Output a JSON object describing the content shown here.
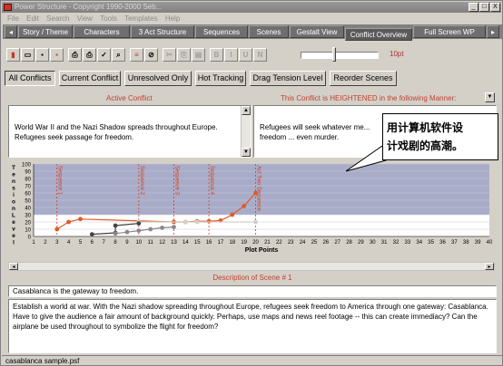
{
  "window": {
    "title": "Power Structure - Copyright 1990-2000 Seb...",
    "buttons": [
      "_",
      "□",
      "X"
    ]
  },
  "menu": [
    "File",
    "Edit",
    "Search",
    "View",
    "Tools",
    "Templates",
    "Help"
  ],
  "tabs": [
    {
      "label": "Story / Theme"
    },
    {
      "label": "Characters"
    },
    {
      "label": "3 Act Structure"
    },
    {
      "label": "Sequences"
    },
    {
      "label": "Scenes"
    },
    {
      "label": "Gestalt View"
    },
    {
      "label": "Conflict Overview"
    },
    {
      "label": "Full Screen WP"
    }
  ],
  "toolbar": {
    "buttons": [
      {
        "icon": "new-doc-icon",
        "glyph": "▮",
        "color": "#c0392b"
      },
      {
        "icon": "open-icon",
        "glyph": "▭",
        "color": "#000"
      },
      {
        "icon": "save-icon",
        "glyph": "▪",
        "color": "#000"
      },
      {
        "icon": "save-all-icon",
        "glyph": "▪",
        "color": "#c0392b"
      },
      {
        "icon": "print-icon",
        "glyph": "⎙",
        "color": "#000"
      },
      {
        "icon": "print-preview-icon",
        "glyph": "⎙",
        "color": "#000"
      },
      {
        "icon": "spell-check-icon",
        "glyph": "✓",
        "color": "#000"
      },
      {
        "icon": "find-icon",
        "glyph": "⌕",
        "color": "#000"
      },
      {
        "icon": "notes-icon",
        "glyph": "≡",
        "color": "#c0392b"
      },
      {
        "icon": "tag-icon",
        "glyph": "⊘",
        "color": "#000"
      },
      {
        "icon": "cut-icon",
        "glyph": "✂",
        "color": "#a0a0a0"
      },
      {
        "icon": "copy-icon",
        "glyph": "⎘",
        "color": "#a0a0a0"
      },
      {
        "icon": "paste-icon",
        "glyph": "▤",
        "color": "#a0a0a0"
      },
      {
        "icon": "bold-icon",
        "glyph": "B",
        "color": "#a0a0a0"
      },
      {
        "icon": "italic-icon",
        "glyph": "I",
        "color": "#a0a0a0"
      },
      {
        "icon": "underline-icon",
        "glyph": "U",
        "color": "#a0a0a0"
      },
      {
        "icon": "strike-icon",
        "glyph": "N",
        "color": "#a0a0a0"
      }
    ],
    "font_size": "10pt"
  },
  "conflict_tabs": [
    {
      "label": "All Conflicts"
    },
    {
      "label": "Current Conflict"
    },
    {
      "label": "Unresolved Only"
    },
    {
      "label": "Hot Tracking"
    },
    {
      "label": "Drag Tension Level"
    },
    {
      "label": "Reorder Scenes"
    }
  ],
  "active_conflict": {
    "label": "Active Conflict",
    "text": "World War II and the Nazi Shadow spreads throughout Europe. Refugees seek passage for freedom."
  },
  "heightened": {
    "label": "This Conflict is HEIGHTENED in the following Manner:",
    "text": "Refugees will seek whatever me... freedom ... even murder."
  },
  "callout": {
    "line1": "用计算机软件设",
    "line2": "计戏剧的高潮。"
  },
  "chart_data": {
    "type": "line",
    "ylabel": "Tension Level",
    "xlabel": "Plot Points",
    "xlim": [
      1,
      40
    ],
    "ylim": [
      0,
      100
    ],
    "yticks": [
      0,
      10,
      20,
      30,
      40,
      50,
      60,
      70,
      80,
      90,
      100
    ],
    "xticks": [
      1,
      2,
      3,
      4,
      5,
      6,
      7,
      8,
      9,
      10,
      11,
      12,
      13,
      14,
      15,
      16,
      17,
      18,
      19,
      20,
      21,
      22,
      23,
      24,
      25,
      26,
      27,
      28,
      29,
      30,
      31,
      32,
      33,
      34,
      35,
      36,
      37,
      38,
      39,
      40
    ],
    "markers": [
      {
        "x": 3,
        "label": "Sequence 1"
      },
      {
        "x": 10,
        "label": "Sequence 2"
      },
      {
        "x": 13,
        "label": "Sequence 3"
      },
      {
        "x": 16,
        "label": "Sequence 4"
      },
      {
        "x": 20,
        "label": "Act Two Sequence"
      }
    ],
    "series": [
      {
        "color": "#e05a2b",
        "points": [
          [
            3,
            10
          ],
          [
            4,
            20
          ],
          [
            5,
            24
          ],
          [
            13,
            20
          ],
          [
            14,
            20
          ],
          [
            15,
            21
          ],
          [
            16,
            21
          ],
          [
            17,
            22
          ],
          [
            18,
            30
          ],
          [
            19,
            42
          ],
          [
            20,
            60
          ]
        ]
      },
      {
        "color": "#d4d0c8",
        "points": [
          [
            10,
            20
          ],
          [
            14,
            20
          ],
          [
            15,
            20
          ],
          [
            20,
            20
          ]
        ]
      },
      {
        "color": "#444444",
        "points": [
          [
            6,
            3
          ],
          [
            8,
            5
          ],
          [
            8,
            15
          ],
          [
            10,
            18
          ]
        ]
      },
      {
        "color": "#888888",
        "points": [
          [
            8,
            4
          ],
          [
            9,
            6
          ],
          [
            10,
            8
          ],
          [
            11,
            10
          ],
          [
            12,
            12
          ],
          [
            13,
            13
          ]
        ]
      }
    ]
  },
  "description": {
    "label": "Description of Scene # 1",
    "summary": "Casablanca is the gateway to freedom.",
    "body": "Establish a world at war.  With the Nazi shadow spreading throughout Europe, refugees seek freedom to America through one gateway: Casablanca.  Have to give the audience a fair amount of background quickly.  Perhaps, use maps and news reel footage -- this can create immediacy?  Can the airplane be used throughout to symbolize the flight for freedom?"
  },
  "status": "casablanca sample.psf"
}
